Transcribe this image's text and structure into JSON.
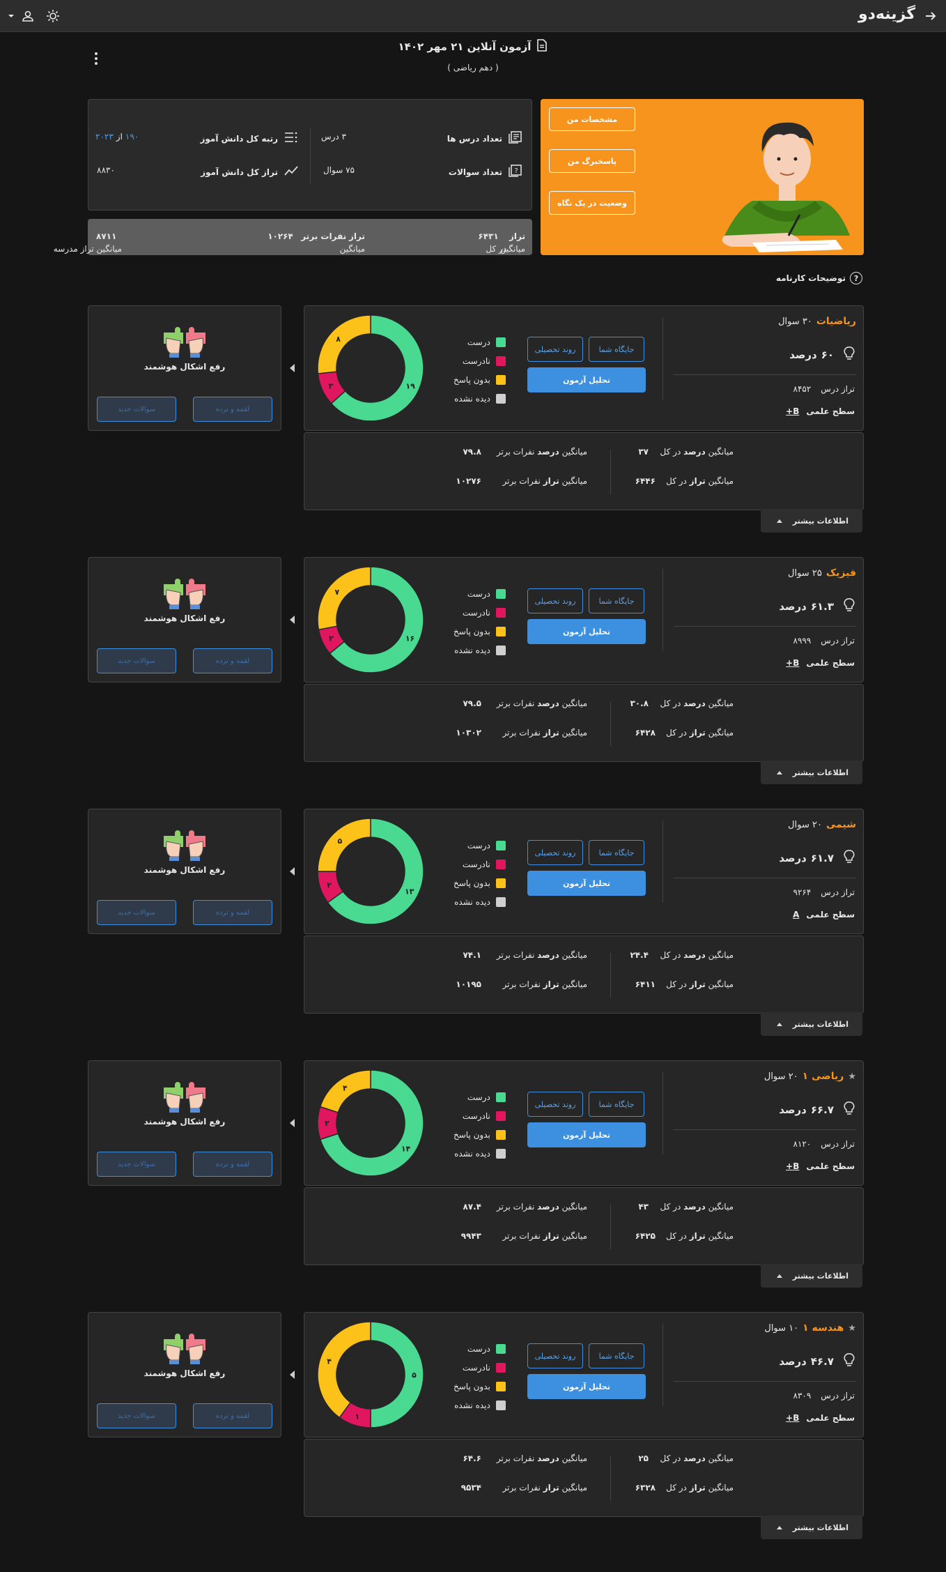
{
  "topbar": {
    "logo": "گزینه‌دو",
    "back": "back-arrow-icon",
    "theme": "sun-icon",
    "user": "user-icon",
    "dropdown": "chevron-down-icon"
  },
  "exam": {
    "title": "آزمون آنلاین ۲۱ مهر ۱۴۰۲",
    "subtitle": "( دهم ریاضی )"
  },
  "hero": {
    "buttons": [
      "مشخصات من",
      "پاسخبرگ من",
      "وضعیت در یک نگاه"
    ]
  },
  "stats": {
    "lessons_label": "تعداد درس ها",
    "lessons_value": "۳ درس",
    "questions_label": "تعداد سوالات",
    "questions_value": "۷۵ سوال",
    "rank_label": "رتبه کل دانش آموز",
    "rank_value": "۱۹۰",
    "rank_of": "از",
    "rank_total": "۲۰۲۳",
    "taraz_label": "تراز کل دانش آموز",
    "taraz_value": "۸۸۳۰"
  },
  "avg": {
    "overall_label_pre": "میانگین",
    "overall_label_bold": "تراز",
    "overall_label_post": "در کل",
    "overall_value": "۶۴۳۱",
    "top_label_pre": "میانگین",
    "top_label_bold": "تراز",
    "top_label_post": "نفرات برتر",
    "top_value": "۱۰۲۶۴",
    "school_label": "میانگین تراز مدرسه",
    "school_value": "۸۷۱۱"
  },
  "description_label": "توضیحات کارنامه",
  "labels": {
    "taraz": "تراز درس",
    "level": "سطح علمی",
    "percent_unit": "درصد",
    "btn_position": "جایگاه شما",
    "btn_trend": "روند تحصیلی",
    "btn_analysis": "تحلیل آزمون",
    "legend": [
      "درست",
      "نادرست",
      "بدون پاسخ",
      "دیده نشده"
    ],
    "avg_percent_pre": "میانگین",
    "avg_percent_bold": "درصد",
    "avg_taraz_bold": "تراز",
    "in_total": "در کل",
    "top_people": "نفرات برتر",
    "more_info": "اطلاعات بیشتر",
    "side_title": "رفع اشکال هوشمند",
    "side_btn1": "لقمه و ترده",
    "side_btn2": "سوالات جدید"
  },
  "colors": {
    "correct": "#4ad991",
    "wrong": "#e0175f",
    "blank": "#fdc21a",
    "unseen": "#cfcfcf",
    "accent": "#f7941d",
    "blue": "#3d8fe0"
  },
  "subjects": [
    {
      "name": "ریاضیات",
      "star": false,
      "questions": "۳۰ سوال",
      "percent": "۶۰",
      "taraz": "۸۴۵۲",
      "level": "B+",
      "correct": 19,
      "wrong": 3,
      "blank": 8,
      "correct_label": "۱۹",
      "wrong_label": "۳",
      "blank_label": "۸",
      "avg_percent": "۳۷",
      "top_percent": "۷۹.۸",
      "avg_taraz": "۶۴۴۶",
      "top_taraz": "۱۰۲۷۶"
    },
    {
      "name": "فیزیک",
      "star": false,
      "questions": "۲۵ سوال",
      "percent": "۶۱.۳",
      "taraz": "۸۹۹۹",
      "level": "B+",
      "correct": 16,
      "wrong": 2,
      "blank": 7,
      "correct_label": "۱۶",
      "wrong_label": "۲",
      "blank_label": "۷",
      "avg_percent": "۳۰.۸",
      "top_percent": "۷۹.۵",
      "avg_taraz": "۶۴۲۸",
      "top_taraz": "۱۰۳۰۲"
    },
    {
      "name": "شیمی",
      "star": false,
      "questions": "۲۰ سوال",
      "percent": "۶۱.۷",
      "taraz": "۹۲۶۴",
      "level": "A",
      "correct": 13,
      "wrong": 2,
      "blank": 5,
      "correct_label": "۱۳",
      "wrong_label": "۲",
      "blank_label": "۵",
      "avg_percent": "۲۴.۴",
      "top_percent": "۷۴.۱",
      "avg_taraz": "۶۴۱۱",
      "top_taraz": "۱۰۱۹۵"
    },
    {
      "name": "ریاضی ۱",
      "star": true,
      "questions": "۲۰ سوال",
      "percent": "۶۶.۷",
      "taraz": "۸۱۲۰",
      "level": "B+",
      "correct": 14,
      "wrong": 2,
      "blank": 4,
      "correct_label": "۱۴",
      "wrong_label": "۲",
      "blank_label": "۴",
      "avg_percent": "۴۳",
      "top_percent": "۸۷.۴",
      "avg_taraz": "۶۴۲۵",
      "top_taraz": "۹۹۴۳"
    },
    {
      "name": "هندسه ۱",
      "star": true,
      "questions": "۱۰ سوال",
      "percent": "۴۶.۷",
      "taraz": "۸۳۰۹",
      "level": "B+",
      "correct": 5,
      "wrong": 1,
      "blank": 4,
      "correct_label": "۵",
      "wrong_label": "۱",
      "blank_label": "۴",
      "avg_percent": "۲۵",
      "top_percent": "۶۴.۶",
      "avg_taraz": "۶۳۲۸",
      "top_taraz": "۹۵۳۴"
    }
  ]
}
